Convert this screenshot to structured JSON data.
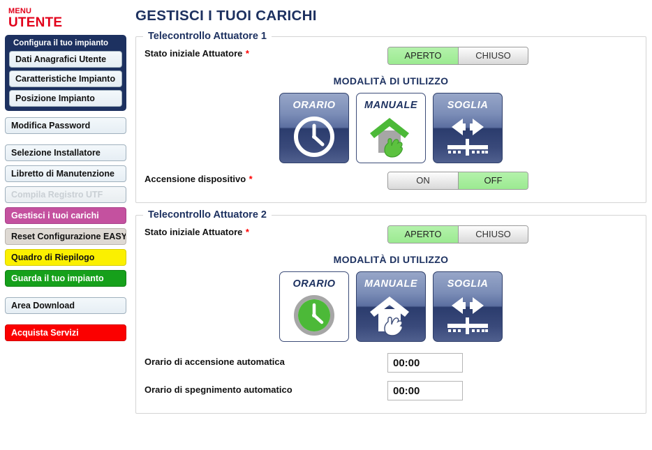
{
  "sidebar": {
    "menu_top_label": "MENU",
    "menu_bottom_label": "UTENTE",
    "group": {
      "title": "Configura il tuo impianto",
      "items": [
        {
          "label": "Dati Anagrafici Utente"
        },
        {
          "label": "Caratteristiche Impianto"
        },
        {
          "label": "Posizione Impianto"
        }
      ]
    },
    "items": [
      {
        "label": "Modifica Password",
        "style": "default"
      },
      {
        "label": "Selezione Installatore",
        "style": "default"
      },
      {
        "label": "Libretto di Manutenzione",
        "style": "default"
      },
      {
        "label": "Compila Registro UTF",
        "style": "disabled"
      },
      {
        "label": "Gestisci i tuoi carichi",
        "style": "magenta"
      },
      {
        "label": "Reset Configurazione EASY",
        "style": "beige"
      },
      {
        "label": "Quadro di Riepilogo",
        "style": "yellow"
      },
      {
        "label": "Guarda il tuo impianto",
        "style": "green"
      },
      {
        "label": "Area Download",
        "style": "default"
      },
      {
        "label": "Acquista Servizi",
        "style": "red"
      }
    ]
  },
  "main": {
    "page_title": "GESTISCI I TUOI CARICHI",
    "required_marker": "*",
    "mode_section_title": "MODALITÀ DI UTILIZZO",
    "panels": [
      {
        "legend": "Telecontrollo Attuatore 1",
        "state_label": "Stato iniziale Attuatore",
        "state_options": [
          "APERTO",
          "CHIUSO"
        ],
        "state_selected": "APERTO",
        "modes": [
          "ORARIO",
          "MANUALE",
          "SOGLIA"
        ],
        "mode_selected": "MANUALE",
        "power_label": "Accensione dispositivo",
        "power_options": [
          "ON",
          "OFF"
        ],
        "power_selected": "OFF"
      },
      {
        "legend": "Telecontrollo Attuatore 2",
        "state_label": "Stato iniziale Attuatore",
        "state_options": [
          "APERTO",
          "CHIUSO"
        ],
        "state_selected": "APERTO",
        "modes": [
          "ORARIO",
          "MANUALE",
          "SOGLIA"
        ],
        "mode_selected": "ORARIO",
        "on_time_label": "Orario di accensione automatica",
        "on_time_value": "00:00",
        "off_time_label": "Orario di spegnimento automatico",
        "off_time_value": "00:00"
      }
    ]
  },
  "colors": {
    "navy": "#1d3160",
    "red": "#e2001a",
    "green_selected": "#9cea91",
    "magenta": "#c4519f",
    "yellow": "#fbf000",
    "green": "#16a01b",
    "bright_red": "#fb0000",
    "icon_green": "#4cb938",
    "icon_grey": "#a6a6a6"
  }
}
